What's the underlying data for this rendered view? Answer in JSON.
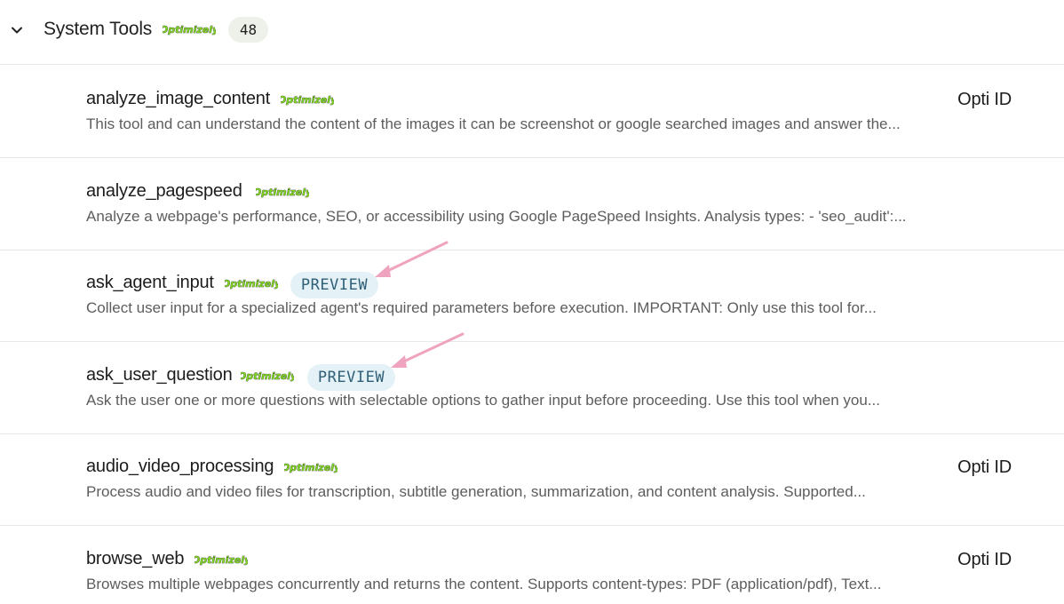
{
  "section": {
    "title": "System Tools",
    "logo_text": "Optimizely",
    "count": "48",
    "chevron_icon": "chevron-down-icon"
  },
  "colors": {
    "logo_fill": "#7ed321",
    "preview_bg": "#e4f1f6",
    "preview_text": "#2f5f77",
    "arrow": "#f0a3bf"
  },
  "tools": [
    {
      "name": "analyze_image_content",
      "logo_text": "Optimizely",
      "description": "This tool and can understand the content of the images it can be screenshot or google searched images and answer the...",
      "auth": "Opti ID"
    },
    {
      "name": "analyze_pagespeed",
      "logo_text": "Optimizely",
      "description": "Analyze a webpage's performance, SEO, or accessibility using Google PageSpeed Insights. Analysis types: - 'seo_audit':...",
      "auth": ""
    },
    {
      "name": "ask_agent_input",
      "logo_text": "Optimizely",
      "badge": "PREVIEW",
      "description": "Collect user input for a specialized agent's required parameters before execution. IMPORTANT: Only use this tool for...",
      "auth": ""
    },
    {
      "name": "ask_user_question",
      "logo_text": "Optimizely",
      "badge": "PREVIEW",
      "description": "Ask the user one or more questions with selectable options to gather input before proceeding. Use this tool when you...",
      "auth": ""
    },
    {
      "name": "audio_video_processing",
      "logo_text": "Optimizely",
      "description": "Process audio and video files for transcription, subtitle generation, summarization, and content analysis. Supported...",
      "auth": "Opti ID"
    },
    {
      "name": "browse_web",
      "logo_text": "Optimizely",
      "description": "Browses multiple webpages concurrently and returns the content. Supports content-types: PDF (application/pdf), Text...",
      "auth": "Opti ID"
    }
  ]
}
